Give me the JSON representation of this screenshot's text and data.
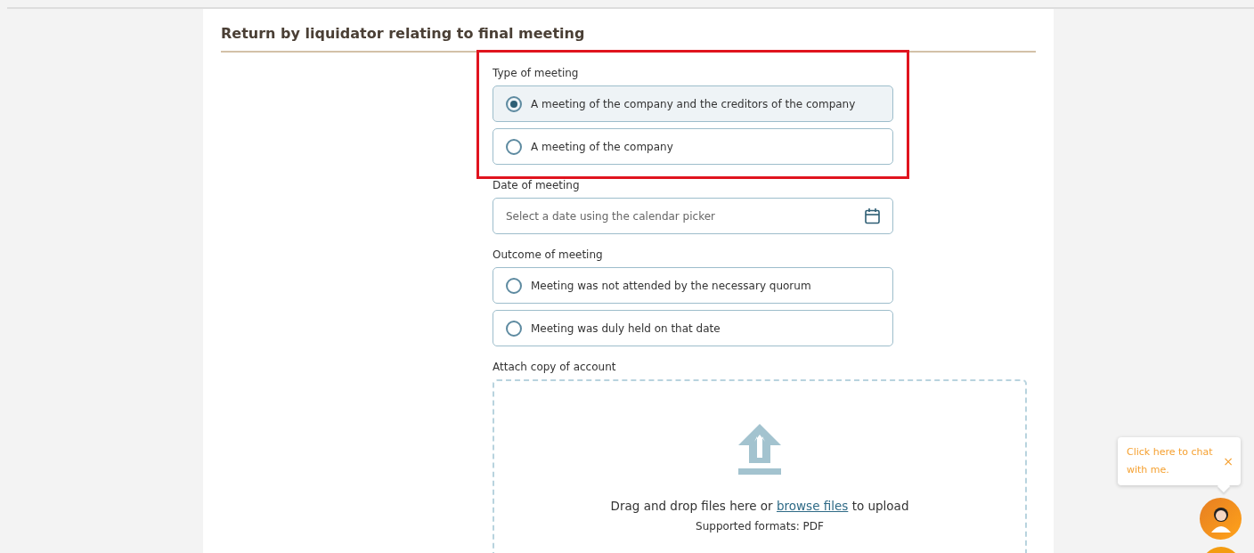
{
  "form_title": "Return by liquidator relating to final meeting",
  "fields": [
    {
      "kind": "radio",
      "label": "Type of meeting",
      "highlighted": true,
      "options": [
        {
          "label": "A meeting of the company and the creditors of the company",
          "selected": true
        },
        {
          "label": "A meeting of the company",
          "selected": false
        }
      ]
    },
    {
      "kind": "date",
      "label": "Date of meeting",
      "placeholder": "Select a date using the calendar picker"
    },
    {
      "kind": "radio",
      "label": "Outcome of meeting",
      "highlighted": false,
      "options": [
        {
          "label": "Meeting was not attended by the necessary quorum",
          "selected": false
        },
        {
          "label": "Meeting was duly held on that date",
          "selected": false
        }
      ]
    },
    {
      "kind": "upload",
      "label": "Attach copy of account",
      "prompt_before": "Drag and drop files here or",
      "link": "browse files",
      "prompt_after": "to upload",
      "formats": "Supported formats: PDF"
    }
  ],
  "chat": {
    "message": "Click here to chat with me.",
    "close": "×"
  }
}
